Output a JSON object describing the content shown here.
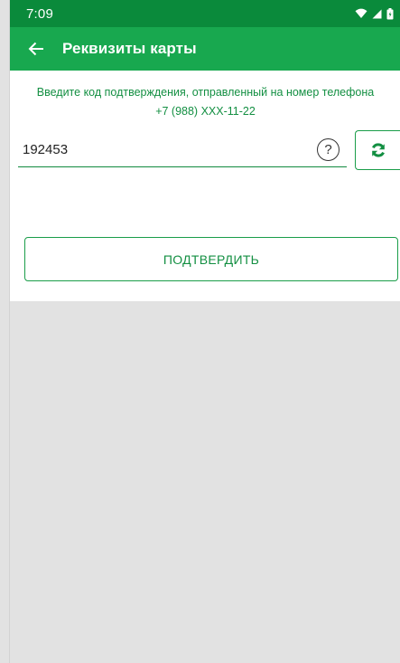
{
  "status_bar": {
    "time": "7:09",
    "icons": [
      "wifi-icon",
      "signal-icon",
      "battery-icon"
    ]
  },
  "app_bar": {
    "title": "Реквизиты карты"
  },
  "form": {
    "instruction_line1": "Введите код подтверждения, отправленный на номер телефона",
    "instruction_line2": "+7 (988) XXX-11-22",
    "code_value": "192453",
    "help_label": "?",
    "confirm_label": "ПОДТВЕРДИТЬ"
  },
  "colors": {
    "status_bar": "#0a8a3b",
    "app_bar": "#18a84f",
    "accent": "#138f42",
    "background": "#e2e2e2"
  }
}
